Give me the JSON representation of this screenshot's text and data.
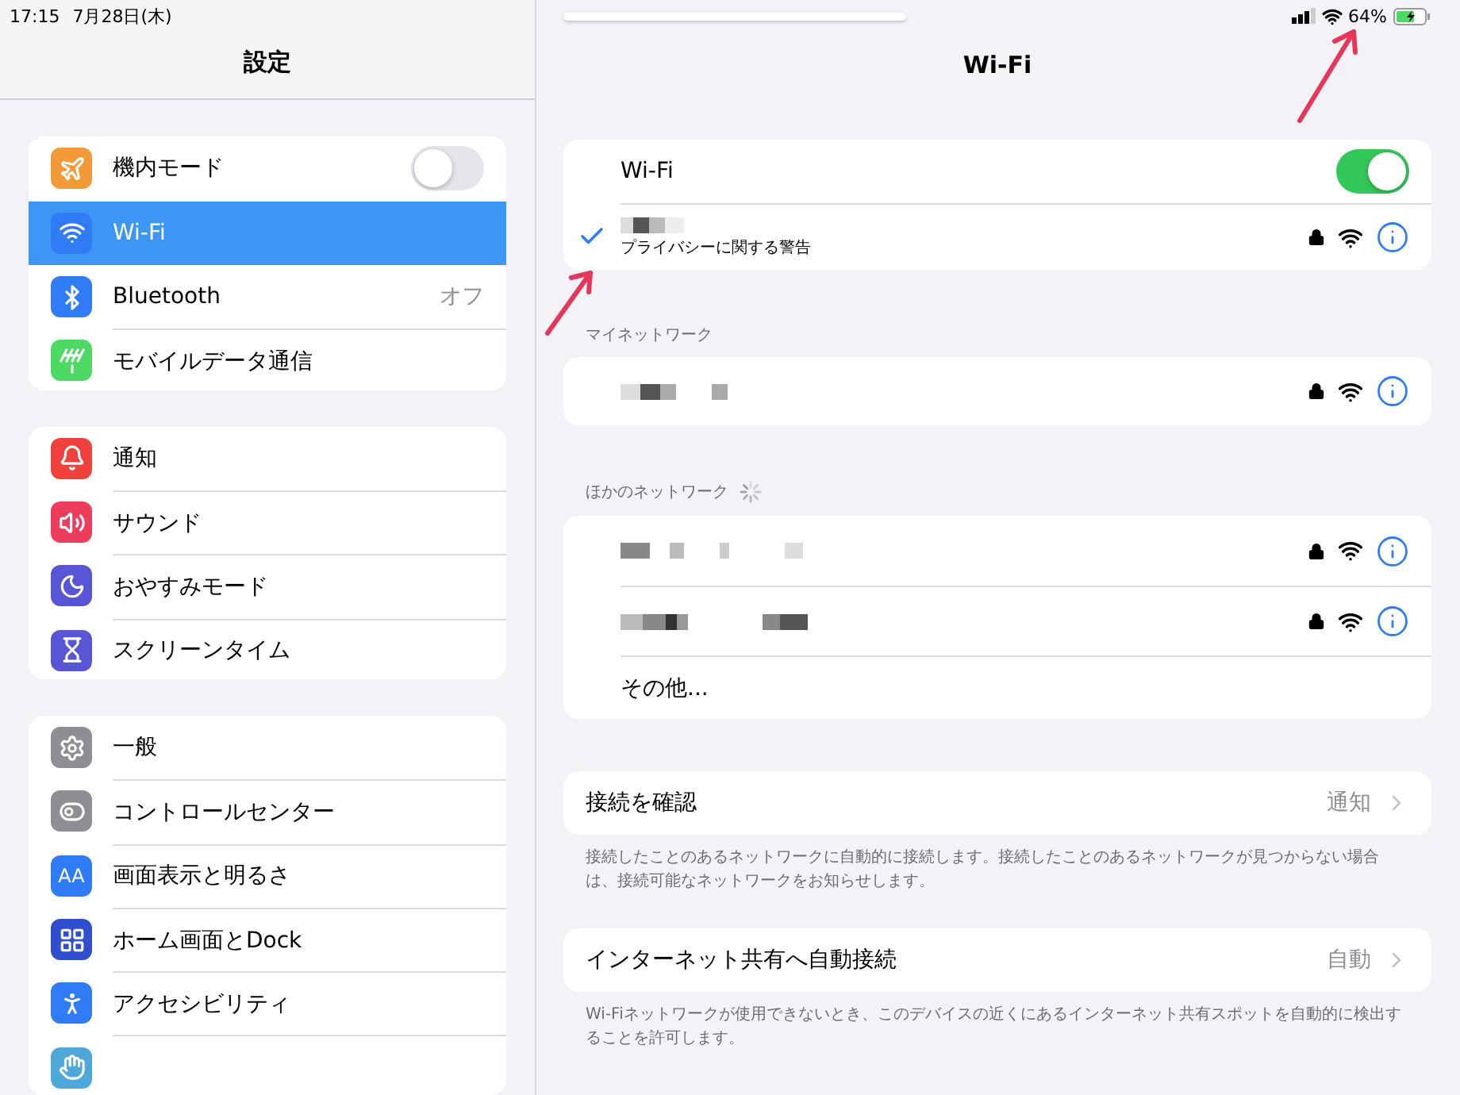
{
  "status_bar": {
    "time": "17:15",
    "date": "7月28日(木)",
    "battery": "64%"
  },
  "sidebar": {
    "title": "設定",
    "groups": [
      {
        "items": [
          {
            "kind": "airplane",
            "label": "機内モード",
            "selected": false,
            "toggle": {
              "on": false
            }
          },
          {
            "kind": "wifi",
            "label": "Wi-Fi",
            "selected": true
          },
          {
            "kind": "bluetooth",
            "label": "Bluetooth",
            "value": "オフ",
            "selected": false
          },
          {
            "kind": "cellular",
            "label": "モバイルデータ通信",
            "selected": false
          }
        ]
      },
      {
        "items": [
          {
            "kind": "notifications",
            "label": "通知",
            "selected": false
          },
          {
            "kind": "sounds",
            "label": "サウンド",
            "selected": false
          },
          {
            "kind": "focus",
            "label": "おやすみモード",
            "selected": false
          },
          {
            "kind": "screentime",
            "label": "スクリーンタイム",
            "selected": false
          }
        ]
      },
      {
        "items": [
          {
            "kind": "general",
            "label": "一般",
            "selected": false
          },
          {
            "kind": "control",
            "label": "コントロールセンター",
            "selected": false
          },
          {
            "kind": "display",
            "icon_text": "AA",
            "label": "画面表示と明るさ",
            "selected": false
          },
          {
            "kind": "home",
            "label": "ホーム画面とDock",
            "selected": false
          },
          {
            "kind": "accessibility",
            "label": "アクセシビリティ",
            "selected": false
          },
          {
            "kind": "partial",
            "selected": false
          }
        ]
      }
    ]
  },
  "main": {
    "title": "Wi-Fi",
    "wifi": {
      "label": "Wi-Fi",
      "on": true
    },
    "current": {
      "checked": true,
      "subtitle": "プライバシーに関する警告",
      "locked": true
    },
    "my_networks": {
      "header": "マイネットワーク",
      "networks": [
        {
          "locked": true
        }
      ]
    },
    "other_networks": {
      "header": "ほかのネットワーク",
      "searching": true,
      "networks": [
        {
          "locked": true
        },
        {
          "locked": true
        }
      ],
      "other": "その他..."
    },
    "settings": [
      {
        "label": "接続を確認",
        "value": "通知",
        "footer": "接続したことのあるネットワークに自動的に接続します。接続したことのあるネットワークが見つからない場合は、接続可能なネットワークをお知らせします。"
      },
      {
        "label": "インターネット共有へ自動接続",
        "value": "自動",
        "footer": "Wi-Fiネットワークが使用できないとき、このデバイスの近くにあるインターネット共有スポットを自動的に検出することを許可します。"
      }
    ]
  }
}
